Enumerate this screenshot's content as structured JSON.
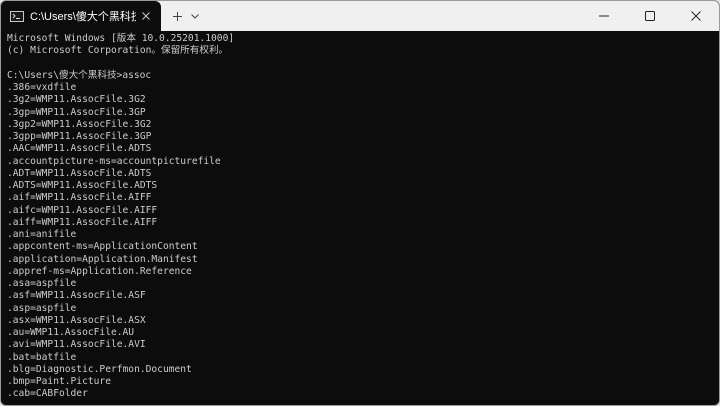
{
  "window": {
    "tab_title": "C:\\Users\\傻大个黑科技\\AppDa",
    "colors": {
      "terminal_bg": "#0c0c0c",
      "terminal_fg": "#cccccc",
      "titlebar_bg": "#f0f0f0"
    },
    "icons": {
      "tab": "terminal-icon",
      "close_tab": "close-icon",
      "new_tab": "plus-icon",
      "dropdown": "chevron-down-icon",
      "minimize": "minimize-icon",
      "maximize": "maximize-icon",
      "close_window": "close-icon"
    }
  },
  "terminal": {
    "lines": [
      "Microsoft Windows [版本 10.0.25201.1000]",
      "(c) Microsoft Corporation。保留所有权利。",
      "",
      "C:\\Users\\傻大个黑科技>assoc",
      ".386=vxdfile",
      ".3g2=WMP11.AssocFile.3G2",
      ".3gp=WMP11.AssocFile.3GP",
      ".3gp2=WMP11.AssocFile.3G2",
      ".3gpp=WMP11.AssocFile.3GP",
      ".AAC=WMP11.AssocFile.ADTS",
      ".accountpicture-ms=accountpicturefile",
      ".ADT=WMP11.AssocFile.ADTS",
      ".ADTS=WMP11.AssocFile.ADTS",
      ".aif=WMP11.AssocFile.AIFF",
      ".aifc=WMP11.AssocFile.AIFF",
      ".aiff=WMP11.AssocFile.AIFF",
      ".ani=anifile",
      ".appcontent-ms=ApplicationContent",
      ".application=Application.Manifest",
      ".appref-ms=Application.Reference",
      ".asa=aspfile",
      ".asf=WMP11.AssocFile.ASF",
      ".asp=aspfile",
      ".asx=WMP11.AssocFile.ASX",
      ".au=WMP11.AssocFile.AU",
      ".avi=WMP11.AssocFile.AVI",
      ".bat=batfile",
      ".blg=Diagnostic.Perfmon.Document",
      ".bmp=Paint.Picture",
      ".cab=CABFolder"
    ]
  }
}
